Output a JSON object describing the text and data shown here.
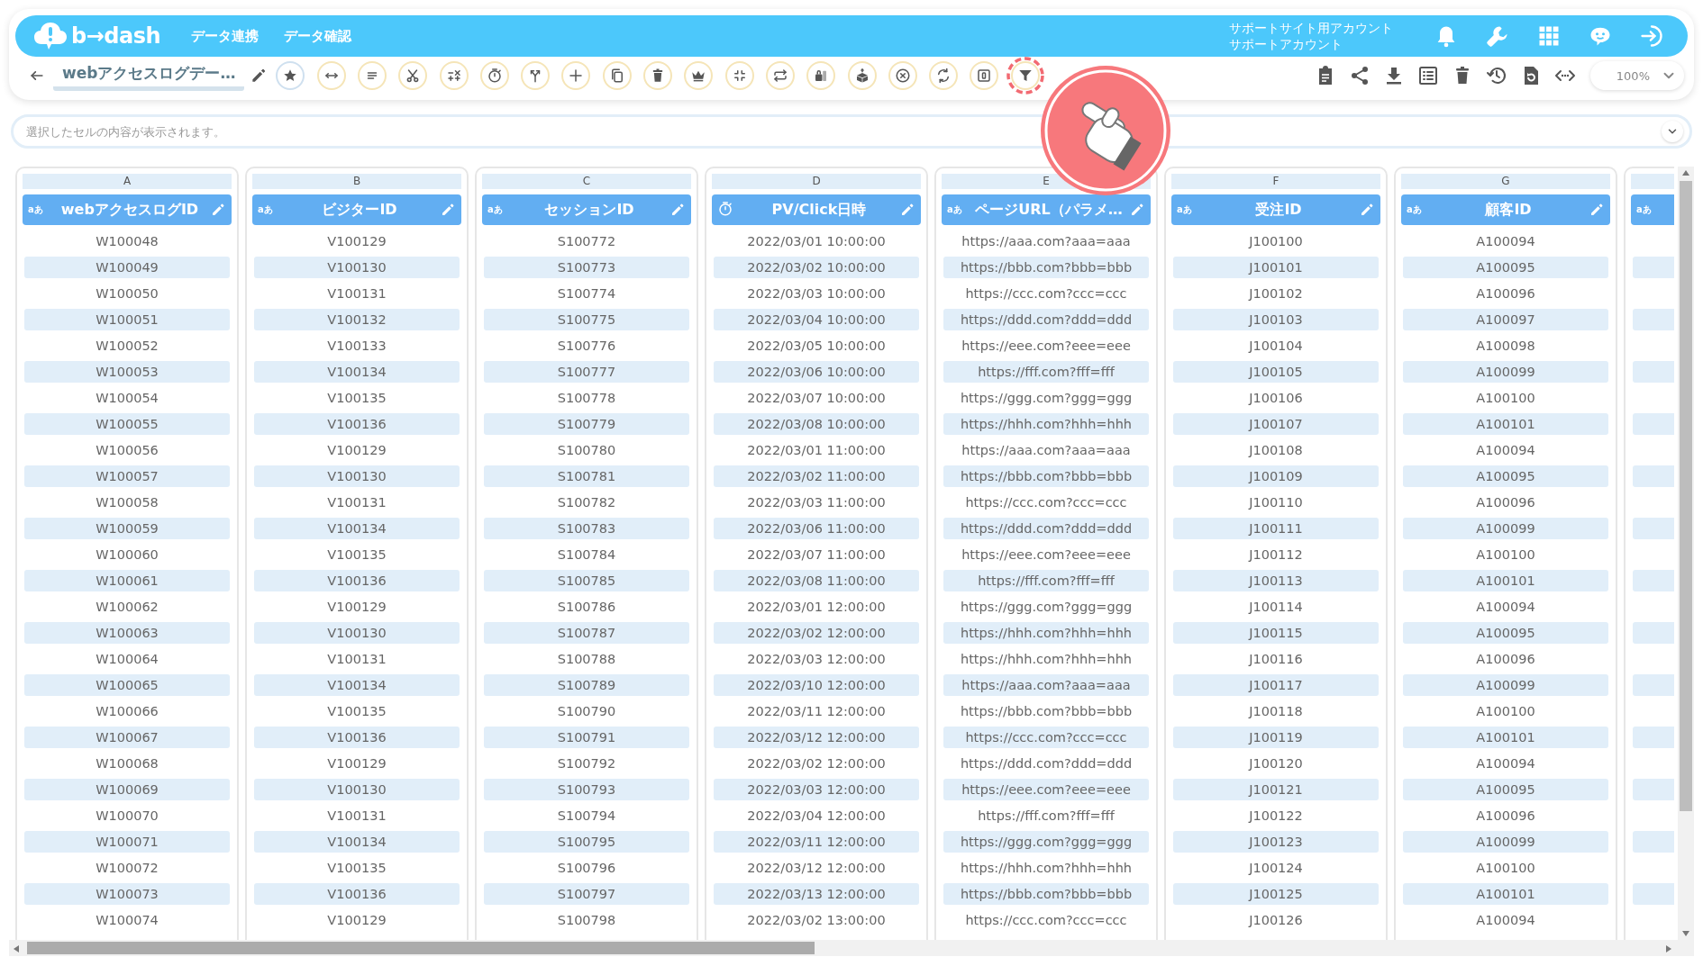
{
  "header": {
    "logo": "b→dash",
    "nav": [
      "データ連携",
      "データ確認"
    ],
    "account": {
      "site": "サポートサイト用アカウント",
      "user": "サポートアカウント"
    },
    "icons": [
      {
        "kind": "bell"
      },
      {
        "kind": "wrench"
      },
      {
        "kind": "grid"
      },
      {
        "kind": "chat"
      },
      {
        "kind": "logout"
      }
    ]
  },
  "toolbar": {
    "title": "webアクセスログデー…",
    "zoom": "100%",
    "tools": [
      {
        "kind": "star",
        "highlighted": false
      },
      {
        "kind": "width",
        "highlighted": false
      },
      {
        "kind": "lines",
        "highlighted": false
      },
      {
        "kind": "scissors",
        "highlighted": false
      },
      {
        "kind": "calc",
        "highlighted": false
      },
      {
        "kind": "stopwatch",
        "highlighted": false
      },
      {
        "kind": "fork",
        "highlighted": false
      },
      {
        "kind": "plus",
        "highlighted": false
      },
      {
        "kind": "copy",
        "highlighted": false
      },
      {
        "kind": "trash",
        "highlighted": false
      },
      {
        "kind": "crown",
        "highlighted": false
      },
      {
        "kind": "compress",
        "highlighted": false
      },
      {
        "kind": "repeat",
        "highlighted": false
      },
      {
        "kind": "lock",
        "highlighted": false
      },
      {
        "kind": "box",
        "highlighted": false
      },
      {
        "kind": "xcircle",
        "highlighted": false
      },
      {
        "kind": "swap",
        "highlighted": false
      },
      {
        "kind": "square",
        "highlighted": false
      },
      {
        "kind": "filter",
        "highlighted": true
      }
    ],
    "actions": [
      {
        "kind": "clipboard"
      },
      {
        "kind": "share"
      },
      {
        "kind": "download"
      },
      {
        "kind": "list"
      },
      {
        "kind": "trash"
      },
      {
        "kind": "history"
      },
      {
        "kind": "filerefresh"
      },
      {
        "kind": "code"
      }
    ]
  },
  "cell_bar": {
    "placeholder": "選択したセルの内容が表示されます。"
  },
  "table": {
    "columns": [
      {
        "letter": "A",
        "title": "webアクセスログID",
        "kind": "text",
        "type_label": "aあ"
      },
      {
        "letter": "B",
        "title": "ビジターID",
        "kind": "text",
        "type_label": "aあ"
      },
      {
        "letter": "C",
        "title": "セッションID",
        "kind": "text",
        "type_label": "aあ"
      },
      {
        "letter": "D",
        "title": "PV/Click日時",
        "kind": "datetime"
      },
      {
        "letter": "E",
        "title": "ページURL（パラメ…",
        "kind": "text",
        "type_label": "aあ"
      },
      {
        "letter": "F",
        "title": "受注ID",
        "kind": "text",
        "type_label": "aあ"
      },
      {
        "letter": "G",
        "title": "顧客ID",
        "kind": "text",
        "type_label": "aあ"
      },
      {
        "kind": "text",
        "type_label": "aあ"
      }
    ],
    "rows": [
      [
        "W100048",
        "V100129",
        "S100772",
        "2022/03/01 10:00:00",
        "https://aaa.com?aaa=aaa",
        "J100100",
        "A100094"
      ],
      [
        "W100049",
        "V100130",
        "S100773",
        "2022/03/02 10:00:00",
        "https://bbb.com?bbb=bbb",
        "J100101",
        "A100095"
      ],
      [
        "W100050",
        "V100131",
        "S100774",
        "2022/03/03 10:00:00",
        "https://ccc.com?ccc=ccc",
        "J100102",
        "A100096"
      ],
      [
        "W100051",
        "V100132",
        "S100775",
        "2022/03/04 10:00:00",
        "https://ddd.com?ddd=ddd",
        "J100103",
        "A100097"
      ],
      [
        "W100052",
        "V100133",
        "S100776",
        "2022/03/05 10:00:00",
        "https://eee.com?eee=eee",
        "J100104",
        "A100098"
      ],
      [
        "W100053",
        "V100134",
        "S100777",
        "2022/03/06 10:00:00",
        "https://fff.com?fff=fff",
        "J100105",
        "A100099"
      ],
      [
        "W100054",
        "V100135",
        "S100778",
        "2022/03/07 10:00:00",
        "https://ggg.com?ggg=ggg",
        "J100106",
        "A100100"
      ],
      [
        "W100055",
        "V100136",
        "S100779",
        "2022/03/08 10:00:00",
        "https://hhh.com?hhh=hhh",
        "J100107",
        "A100101"
      ],
      [
        "W100056",
        "V100129",
        "S100780",
        "2022/03/01 11:00:00",
        "https://aaa.com?aaa=aaa",
        "J100108",
        "A100094"
      ],
      [
        "W100057",
        "V100130",
        "S100781",
        "2022/03/02 11:00:00",
        "https://bbb.com?bbb=bbb",
        "J100109",
        "A100095"
      ],
      [
        "W100058",
        "V100131",
        "S100782",
        "2022/03/03 11:00:00",
        "https://ccc.com?ccc=ccc",
        "J100110",
        "A100096"
      ],
      [
        "W100059",
        "V100134",
        "S100783",
        "2022/03/06 11:00:00",
        "https://ddd.com?ddd=ddd",
        "J100111",
        "A100099"
      ],
      [
        "W100060",
        "V100135",
        "S100784",
        "2022/03/07 11:00:00",
        "https://eee.com?eee=eee",
        "J100112",
        "A100100"
      ],
      [
        "W100061",
        "V100136",
        "S100785",
        "2022/03/08 11:00:00",
        "https://fff.com?fff=fff",
        "J100113",
        "A100101"
      ],
      [
        "W100062",
        "V100129",
        "S100786",
        "2022/03/01 12:00:00",
        "https://ggg.com?ggg=ggg",
        "J100114",
        "A100094"
      ],
      [
        "W100063",
        "V100130",
        "S100787",
        "2022/03/02 12:00:00",
        "https://hhh.com?hhh=hhh",
        "J100115",
        "A100095"
      ],
      [
        "W100064",
        "V100131",
        "S100788",
        "2022/03/03 12:00:00",
        "https://hhh.com?hhh=hhh",
        "J100116",
        "A100096"
      ],
      [
        "W100065",
        "V100134",
        "S100789",
        "2022/03/10 12:00:00",
        "https://aaa.com?aaa=aaa",
        "J100117",
        "A100099"
      ],
      [
        "W100066",
        "V100135",
        "S100790",
        "2022/03/11 12:00:00",
        "https://bbb.com?bbb=bbb",
        "J100118",
        "A100100"
      ],
      [
        "W100067",
        "V100136",
        "S100791",
        "2022/03/12 12:00:00",
        "https://ccc.com?ccc=ccc",
        "J100119",
        "A100101"
      ],
      [
        "W100068",
        "V100129",
        "S100792",
        "2022/03/02 12:00:00",
        "https://ddd.com?ddd=ddd",
        "J100120",
        "A100094"
      ],
      [
        "W100069",
        "V100130",
        "S100793",
        "2022/03/03 12:00:00",
        "https://eee.com?eee=eee",
        "J100121",
        "A100095"
      ],
      [
        "W100070",
        "V100131",
        "S100794",
        "2022/03/04 12:00:00",
        "https://fff.com?fff=fff",
        "J100122",
        "A100096"
      ],
      [
        "W100071",
        "V100134",
        "S100795",
        "2022/03/11 12:00:00",
        "https://ggg.com?ggg=ggg",
        "J100123",
        "A100099"
      ],
      [
        "W100072",
        "V100135",
        "S100796",
        "2022/03/12 12:00:00",
        "https://hhh.com?hhh=hhh",
        "J100124",
        "A100100"
      ],
      [
        "W100073",
        "V100136",
        "S100797",
        "2022/03/13 12:00:00",
        "https://bbb.com?bbb=bbb",
        "J100125",
        "A100101"
      ],
      [
        "W100074",
        "V100129",
        "S100798",
        "2022/03/02 13:00:00",
        "https://ccc.com?ccc=ccc",
        "J100126",
        "A100094"
      ]
    ]
  }
}
